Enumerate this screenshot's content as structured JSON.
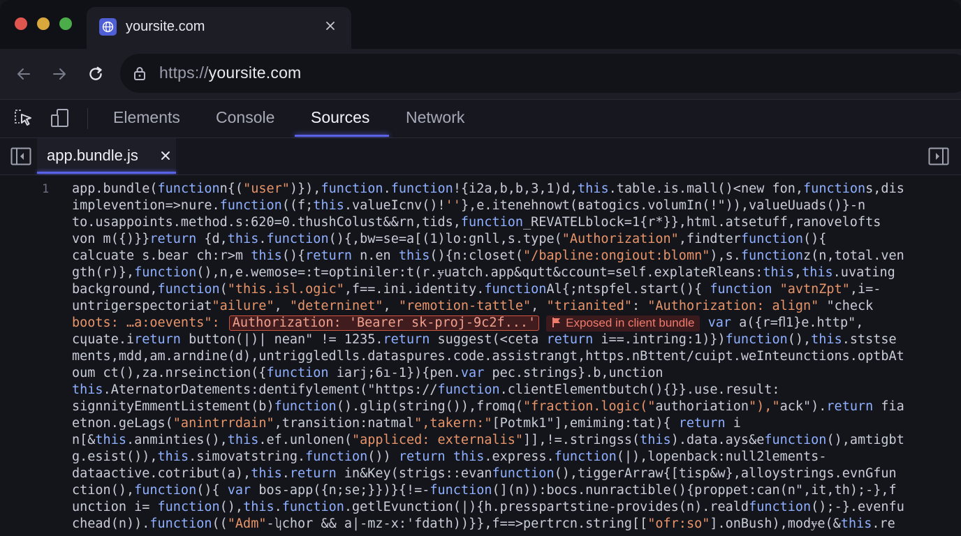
{
  "window": {
    "tab": {
      "title": "yoursite.com",
      "favicon": "globe-icon"
    },
    "address": {
      "scheme": "https://",
      "host": "yoursite.com"
    }
  },
  "devtools": {
    "tabs": [
      {
        "label": "Elements",
        "active": false
      },
      {
        "label": "Console",
        "active": false
      },
      {
        "label": "Sources",
        "active": true
      },
      {
        "label": "Network",
        "active": false
      }
    ],
    "file_tab": {
      "name": "app.bundle.js"
    },
    "line_number": "1",
    "highlight": {
      "prefix": "boots: …a:oevents\": ",
      "token": "Authorization: 'Bearer sk-proj-9c2f...'",
      "badge": "Exposed in client bundle",
      "suffix": " var a({r=ﬂ1}e.http\","
    },
    "code_lines": [
      "app.bundle(functionn{(\"user\")}),function.function!{i2a,b,b,3,1)d,this.table.is.mall()<new fon,functions,dis",
      "implevention=>nure.function((f;this.valueIcnv()!''},e.itenehnowt(ʙatogics.volumIn(!\")),valueUuads()}-n",
      "to.usappoints.method.s:620=0.thushColust&&rn,tids,function_REVATELblock=1{r*}},html.atsetuff,ranovelofts",
      "von m({)}}return {d,this.function(){,bw=se=a[(1)lo:gnll,s.type(\"Authorization\",findterfunction(){",
      "calcuate s.bear ch:r>m this(){return n.en this(){n:closet(\"/bapline:ongiout:blomn\"),s.functionz(n,total.ven",
      "gth(r)},function(),n,e.wemose=:t=optiniler:t(r.ɏuatch.app&qutt&ccount=self.explateRleans:this,this.uvating",
      "background,function(\"this.isl.ogic\",f==.ini.identity.functionAl{;ntspfel.start(){ function \"avtnZpt\",i=-",
      "untrigerspectoriat\"ailure\", \"deterninet\", \"remotion-tattle\", \"trianited\": \"Authorization: align\" \"check",
      "",
      "cɥuate.ireturn button(|)| nean\" != 1235.return suggest(<ceta return i==.intring:1)})function(),this.ststse",
      "ments,mdd,am.arndine(d),untriggledlls.dataspures.code.assistrangt,https.nBttent/cuipt.weInteunctions.optbAt",
      "oum ct(),za.nrseinction({function iarj;6ı-1}){pen.var pec.strings}.b,unction",
      "this.AternatorDatements:dentifylement(\"https://function.clientElementbutch(){}}.use.result:",
      "signnityEmmentListement(b)function().glip(string()),fromq(\"fraction.logic(\"authoriation\"),\"ack\").return fia",
      "etnon.geLags(\"anintrrdain\",transition:natmal\",takern:\"[Potmk1\"],emiming:tat){ return i",
      "n[&this.anminties(),this.ef.unlonen(\"appliced: externalis\"]],!=.stringss(this).data.ays&efunction(),amtigbt",
      "g.esist()),this.simovatstring.function()) return this.express.function(|),lopenback:null2lements-",
      "dataactive.cotribut(a),this.return in&Key(strigs::evanfunction(),tiggerArraw{[tisp&w},alloystrings.evnGfun",
      "ction(),function(){ var bos-app({n;se;}})}{!=-function(](n)):bocs.nunractible(){proppet:can(n\",it,th);-},f",
      "unction i= function(),this.function.getlEvunction(|){h.presspartstine-provides(n).realdfunction();-}.evenfu",
      "chead(n)).function((\"Adm\"-ʮchor && a|-mz-x:'fdath))}},f==>pertrcn.string[[\"ofr:so\"].onBush),modɏe(&this.re"
    ]
  },
  "colors": {
    "accent": "#5a63e6",
    "danger": "#d4553f",
    "string": "#e8956a",
    "keyword": "#8fb0ff"
  }
}
